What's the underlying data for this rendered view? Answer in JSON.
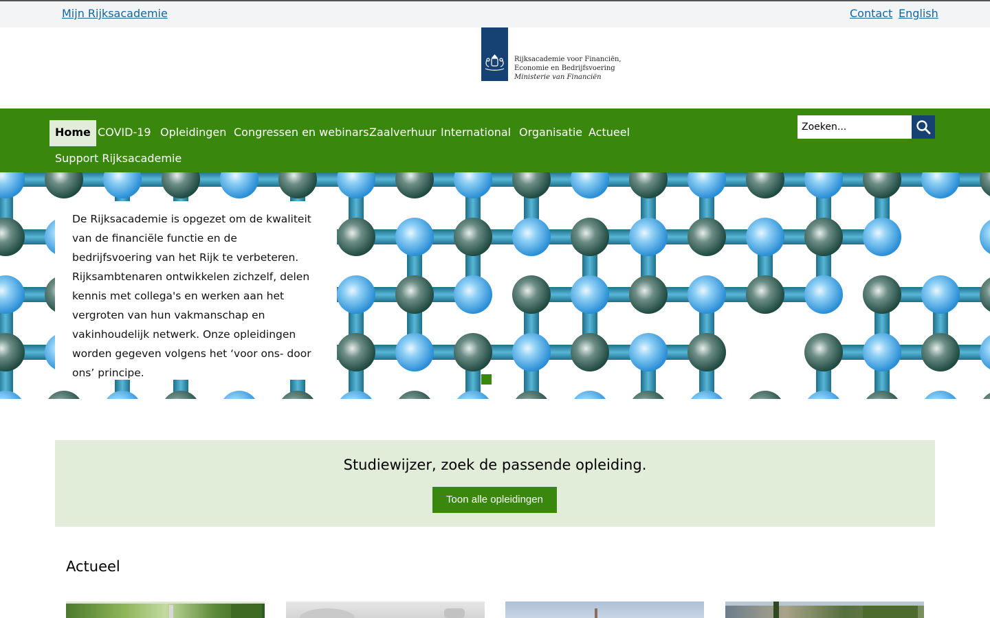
{
  "topbar": {
    "mijn_label": "Mijn Rijksacademie",
    "contact_label": "Contact",
    "english_label": "English"
  },
  "logo": {
    "line1": "Rijksacademie voor Financiën,",
    "line2": "Economie en Bedrijfsvoering",
    "line3": "Ministerie van Financiën",
    "icon": "coat-of-arms-icon",
    "color": "#154273"
  },
  "nav": {
    "items": [
      {
        "label": "Home",
        "active": true
      },
      {
        "label": "COVID-19"
      },
      {
        "label": "Opleidingen"
      },
      {
        "label": "Congressen en webinars"
      },
      {
        "label": "Zaalverhuur"
      },
      {
        "label": "International"
      },
      {
        "label": "Organisatie"
      },
      {
        "label": "Actueel"
      },
      {
        "label": "Support Rijksacademie"
      }
    ],
    "color": "#39870c",
    "active_bg": "#e1ecd9"
  },
  "search": {
    "placeholder": "Zoeken...",
    "icon": "search-icon",
    "button_color": "#154273"
  },
  "hero": {
    "text": "De Rijksacademie is opgezet om de kwaliteit van de financiële functie en de bedrijfsvoering van het Rijk te verbeteren. Rijksambtenaren ontwikkelen zichzelf, delen kennis met collega's en werken aan het vergroten van hun vakmanschap en vakinhoudelijk netwerk. Onze opleidingen worden gegeven volgens het ‘voor ons- door ons’ principe.",
    "pattern": "molecule-pattern",
    "slide_indicator": "slide-indicator-1"
  },
  "studiewijzer": {
    "heading": "Studiewijzer, zoek de passende opleiding.",
    "button_label": "Toon alle opleidingen",
    "bg": "#e1ecd9"
  },
  "actueel": {
    "heading": "Actueel",
    "cards": [
      {
        "image": "garden-photo"
      },
      {
        "image": "grey-photo"
      },
      {
        "image": "sky-photo"
      },
      {
        "image": "landscape-photo"
      }
    ]
  }
}
